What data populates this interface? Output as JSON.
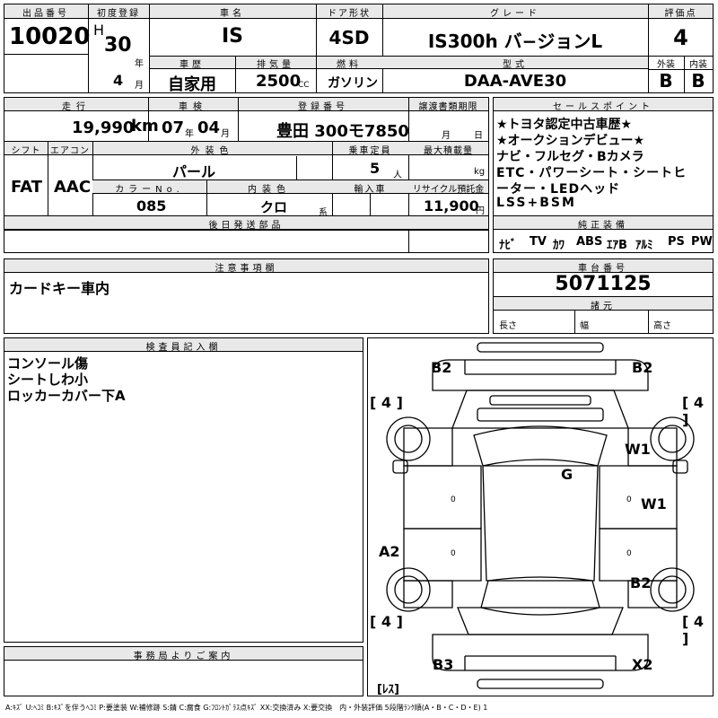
{
  "top": {
    "lot_label": "出品番号",
    "lot_no": "10020",
    "first_reg_label": "初度登録",
    "era": "H",
    "year": "30",
    "year_unit": "年",
    "month": "4",
    "month_unit": "月",
    "car_name_label": "車名",
    "car_name": "IS",
    "door_label": "ドア形状",
    "door": "4SD",
    "grade_label": "グレード",
    "grade": "IS300h バ−ジョンL",
    "score_label": "評価点",
    "score": "4",
    "history_label": "車歴",
    "history": "自家用",
    "displacement_label": "排気量",
    "displacement": "2500",
    "cc": "CC",
    "fuel_label": "燃料",
    "fuel": "ガソリン",
    "model_label": "型式",
    "model": "DAA-AVE30",
    "exterior_label": "外装",
    "exterior": "B",
    "interior_label": "内装",
    "interior": "B"
  },
  "row2": {
    "mileage_label": "走行",
    "mileage": "19,990",
    "km": "km",
    "inspection_label": "車検",
    "insp_year": "07",
    "year_unit": "年",
    "insp_month": "04",
    "month_unit": "月",
    "reg_no_label": "登録番号",
    "reg_no": "豊田 300モ7850",
    "transfer_label": "譲渡書類期限",
    "transfer_month": "月",
    "transfer_day": "日",
    "shift_label": "シフト",
    "shift": "FAT",
    "ac_label": "エアコン",
    "ac": "AAC",
    "ext_color_label": "外装色",
    "ext_color": "パール",
    "capacity_label": "乗車定員",
    "capacity": "5",
    "capacity_unit": "人",
    "load_label": "最大積載量",
    "load_unit": "kg",
    "color_no_label": "カラーNo.",
    "color_no": "085",
    "int_color_label": "内装色",
    "int_color": "クロ",
    "int_unit": "系",
    "import_label": "輸入車",
    "recycle_label": "リサイクル預託金",
    "recycle": "11,900",
    "recycle_unit": "円",
    "later_parts_label": "後日発送部品"
  },
  "sales": {
    "label": "セールスポイント",
    "lines": [
      "★トヨタ認定中古車歴★",
      "★オークションデビュー★",
      "ナビ・フルセグ・Bカメラ",
      "ETC・パワーシート・シートヒ",
      "ーター・LEDヘッド",
      "LSS+BSM"
    ]
  },
  "equipment": {
    "label": "純正装備",
    "items": [
      "ﾅﾋﾞ",
      "TV",
      "ｶﾜ",
      "ABS",
      "ｴｱB",
      "ｱﾙﾐ",
      "PS",
      "PW"
    ]
  },
  "notes": {
    "label": "注意事項欄",
    "text": "カードキー車内"
  },
  "chassis": {
    "label": "車台番号",
    "number": "5071125",
    "dims_label": "諸元",
    "length": "長さ",
    "width": "幅",
    "height": "高さ"
  },
  "inspector": {
    "label": "検査員記入欄",
    "lines": [
      "コンソール傷",
      "シートしわ小",
      "ロッカーカバー下A"
    ]
  },
  "office": {
    "label": "事務局よりご案内"
  },
  "diagram": {
    "marks": {
      "b2_front_left": "B2",
      "b2_front_right": "B2",
      "tire_fl": "[ 4 ]",
      "tire_fr": "[ 4 ]",
      "tire_rl": "[ 4 ]",
      "tire_rr": "[ 4 ]",
      "w1_top": "W1",
      "w1_mid": "W1",
      "g": "G",
      "a2": "A2",
      "b2_rear": "B2",
      "b3": "B3",
      "x2": "X2",
      "les": "[ﾚｽ]",
      "zero_l1": "0",
      "zero_l2": "0",
      "zero_r1": "0",
      "zero_r2": "0"
    }
  },
  "legend": "A:ｷｽﾞ U:ﾍｺﾐ B:ｷｽﾞを伴うﾍｺﾐ P:要塗装 W:補修跡 S:錆 C:腐食 G:ﾌﾛﾝﾄｶﾞﾗｽ点ｷｽﾞ XX:交換済み X:要交換　内・外装評価 5段階ﾗﾝｸ順(A・B・C・D・E) 1"
}
